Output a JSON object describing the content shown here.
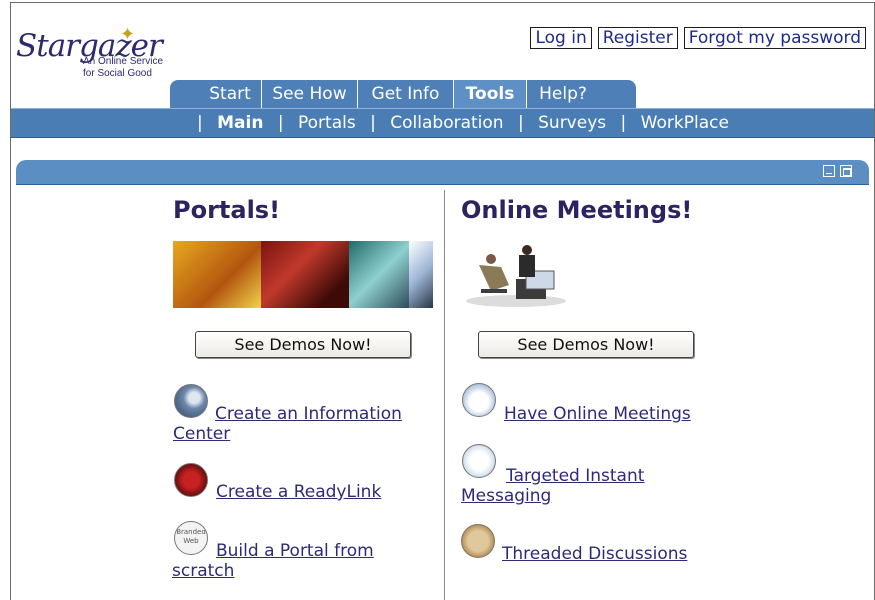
{
  "logo": {
    "wordmark": "Stargazer",
    "tagline_line1": "An Online Service",
    "tagline_line2": "for Social Good"
  },
  "toplinks": {
    "login": "Log in",
    "register": "Register",
    "forgot": "Forgot my password"
  },
  "tabs": [
    {
      "label": "Start"
    },
    {
      "label": "See How"
    },
    {
      "label": "Get Info"
    },
    {
      "label": "Tools"
    },
    {
      "label": "Help?"
    }
  ],
  "subnav": {
    "main": "Main",
    "portals": "Portals",
    "collaboration": "Collaboration",
    "surveys": "Surveys",
    "workplace": "WorkPlace"
  },
  "left": {
    "title": "Portals!",
    "demo_button": "See Demos Now!",
    "links": [
      {
        "text_line1": "Create an Information",
        "text_line2": "Center",
        "icon": "info-center-icon"
      },
      {
        "text_line1": "Create a ReadyLink",
        "text_line2": "",
        "icon": "readylink-icon"
      },
      {
        "text_line1": "Build a Portal from",
        "text_line2": "scratch",
        "icon": "branded-web-icon",
        "icon_text": "Branded Web"
      }
    ]
  },
  "right": {
    "title": "Online Meetings!",
    "demo_button": "See Demos Now!",
    "links": [
      {
        "text_line1": "Have Online Meetings",
        "text_line2": "",
        "icon": "coffee-cup-icon"
      },
      {
        "text_line1": "Targeted Instant",
        "text_line2": "Messaging",
        "icon": "chat-bubbles-icon"
      },
      {
        "text_line1": "Threaded Discussions",
        "text_line2": "",
        "icon": "discussion-envelope-icon"
      }
    ]
  },
  "colors": {
    "nav_blue": "#4e7fb6",
    "title_purple": "#2d2361",
    "link_blue": "#2d2a78"
  }
}
